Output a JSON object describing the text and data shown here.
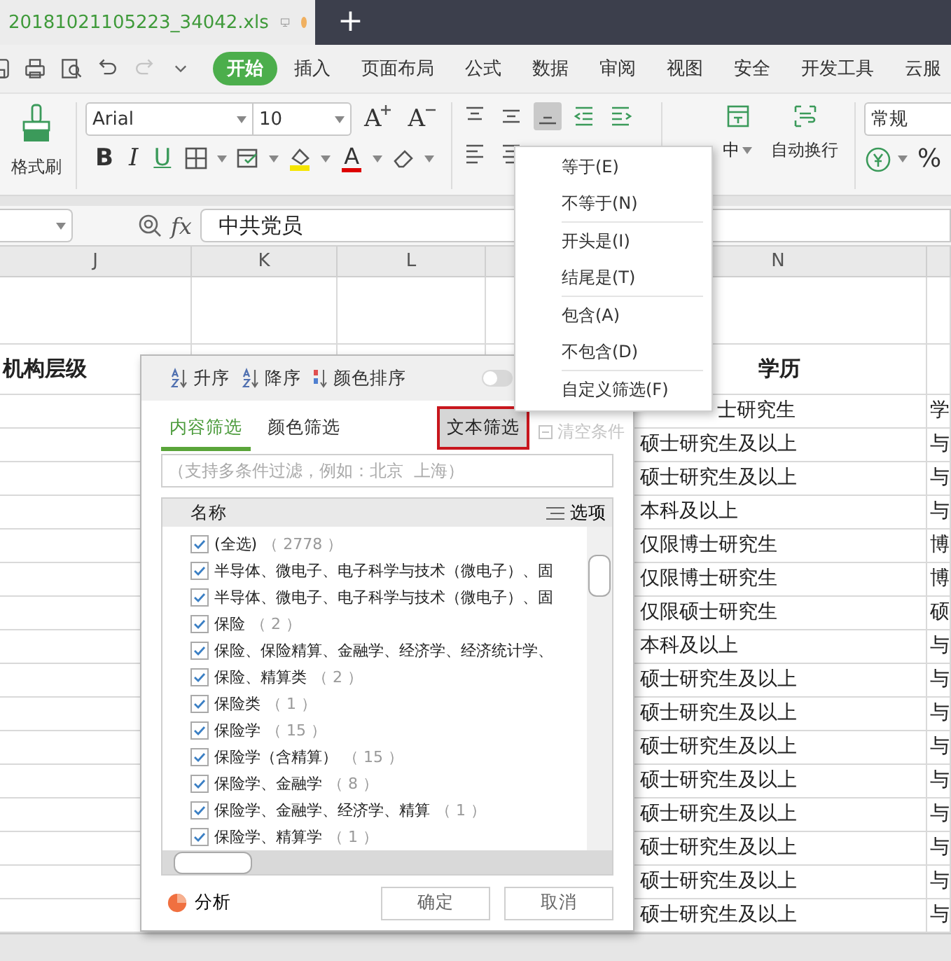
{
  "title_bar": {
    "file_name": "20181021105223_34042.xls",
    "new_tab": "+"
  },
  "menu_tabs": [
    {
      "label": "开始",
      "selected": true
    },
    {
      "label": "插入",
      "selected": false
    },
    {
      "label": "页面布局",
      "selected": false
    },
    {
      "label": "公式",
      "selected": false
    },
    {
      "label": "数据",
      "selected": false
    },
    {
      "label": "审阅",
      "selected": false
    },
    {
      "label": "视图",
      "selected": false
    },
    {
      "label": "安全",
      "selected": false
    },
    {
      "label": "开发工具",
      "selected": false
    },
    {
      "label": "云服",
      "selected": false
    }
  ],
  "ribbon": {
    "format_painter": "格式刷",
    "font": "Arial",
    "font_size": "10",
    "size_buttons": [
      {
        "kind": "grow",
        "label": "A"
      },
      {
        "kind": "shrink",
        "label": "A"
      }
    ],
    "style_buttons": [
      {
        "kind": "bold",
        "label": "B"
      },
      {
        "kind": "italic",
        "label": "I"
      },
      {
        "kind": "underline",
        "label": "U"
      }
    ],
    "font_color_label": "A",
    "merge_label": "中",
    "wrap_label": "自动换行",
    "number_format": "常规",
    "percent": "%"
  },
  "formula_bar": {
    "fx": "fx",
    "value": "中共党员"
  },
  "sheet": {
    "columns": [
      {
        "label": "J"
      },
      {
        "label": "K"
      },
      {
        "label": "L"
      },
      {
        "label": "N"
      }
    ],
    "header_row": {
      "column_j": "机构层级",
      "column_n": "学历"
    },
    "rows": [
      {
        "column_n": "士研究生",
        "column_o": "学"
      },
      {
        "column_n": "硕士研究生及以上",
        "column_o": "与"
      },
      {
        "column_n": "硕士研究生及以上",
        "column_o": "与"
      },
      {
        "column_n": "本科及以上",
        "column_o": "与"
      },
      {
        "column_n": "仅限博士研究生",
        "column_o": "博"
      },
      {
        "column_n": "仅限博士研究生",
        "column_o": "博"
      },
      {
        "column_n": "仅限硕士研究生",
        "column_o": "硕"
      },
      {
        "column_n": "本科及以上",
        "column_o": "与"
      },
      {
        "column_n": "硕士研究生及以上",
        "column_o": "与"
      },
      {
        "column_n": "硕士研究生及以上",
        "column_o": "与"
      },
      {
        "column_n": "硕士研究生及以上",
        "column_o": "与"
      },
      {
        "column_n": "硕士研究生及以上",
        "column_o": "与"
      },
      {
        "column_n": "硕士研究生及以上",
        "column_o": "与"
      },
      {
        "column_n": "硕士研究生及以上",
        "column_o": "与"
      },
      {
        "column_n": "硕士研究生及以上",
        "column_o": "与"
      },
      {
        "column_n": "硕士研究生及以上",
        "column_o": "与"
      }
    ]
  },
  "filter_panel": {
    "sort_buttons": [
      {
        "kind": "ascending",
        "label": "升序"
      },
      {
        "kind": "descending",
        "label": "降序"
      },
      {
        "kind": "color",
        "label": "颜色排序"
      }
    ],
    "toggle_on": false,
    "tabs": [
      {
        "label": "内容筛选",
        "selected": true
      },
      {
        "label": "颜色筛选",
        "selected": false
      }
    ],
    "text_filter_button": "文本筛选",
    "clear_button": "清空条件",
    "search": {
      "placeholder": "（支持多条件过滤，例如：北京  上海）"
    },
    "list_header": "名称",
    "options_button": "选项",
    "items": [
      {
        "label": "(全选)",
        "count": "（ 2778 ）",
        "checked": true
      },
      {
        "label": "半导体、微电子、电子科学与技术（微电子）、固",
        "checked": true
      },
      {
        "label": "半导体、微电子、电子科学与技术（微电子）、固",
        "checked": true
      },
      {
        "label": "保险",
        "count": "（ 2 ）",
        "checked": true
      },
      {
        "label": "保险、保险精算、金融学、经济学、经济统计学、",
        "checked": true
      },
      {
        "label": "保险、精算类",
        "count": "（ 2 ）",
        "checked": true
      },
      {
        "label": "保险类",
        "count": "（ 1 ）",
        "checked": true
      },
      {
        "label": "保险学",
        "count": "（ 15 ）",
        "checked": true
      },
      {
        "label": "保险学（含精算）",
        "count": "（ 15 ）",
        "checked": true
      },
      {
        "label": "保险学、金融学",
        "count": "（ 8 ）",
        "checked": true
      },
      {
        "label": "保险学、金融学、经济学、精算",
        "count": "（ 1 ）",
        "checked": true
      },
      {
        "label": "保险学、精算学",
        "count": "（ 1 ）",
        "checked": true
      }
    ],
    "analyze_button": "分析",
    "ok_button": "确定",
    "cancel_button": "取消"
  },
  "text_filter_menu": [
    {
      "items": [
        "等于(E)",
        "不等于(N)"
      ]
    },
    {
      "items": [
        "开头是(I)",
        "结尾是(T)"
      ]
    },
    {
      "items": [
        "包含(A)",
        "不包含(D)"
      ]
    },
    {
      "items": [
        "自定义筛选(F)"
      ]
    }
  ]
}
